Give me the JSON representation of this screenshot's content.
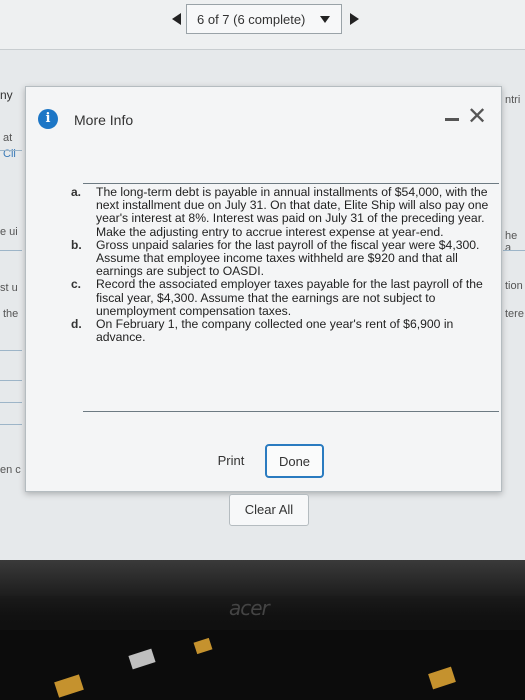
{
  "pager": {
    "label": "6 of 7 (6 complete)"
  },
  "background": {
    "fragments": [
      "ny",
      "at",
      "Cli",
      "e ui",
      "st u",
      "the",
      "en c",
      "ntri",
      "he a",
      "tion",
      "tere"
    ]
  },
  "modal": {
    "title": "More Info",
    "items": [
      {
        "letter": "a.",
        "text": "The long-term debt is payable in annual installments of $54,000, with the next installment due on July 31. On that date, Elite Ship will also pay one year's interest at 8%. Interest was paid on July 31 of the preceding year. Make the adjusting entry to accrue interest expense at year-end."
      },
      {
        "letter": "b.",
        "text": "Gross unpaid salaries for the last payroll of the fiscal year were $4,300. Assume that employee income taxes withheld are $920 and that all earnings are subject to OASDI."
      },
      {
        "letter": "c.",
        "text": "Record the associated employer taxes payable for the last payroll of the fiscal year, $4,300. Assume that the earnings are not subject to unemployment compensation taxes."
      },
      {
        "letter": "d.",
        "text": "On February 1, the company collected one year's rent of $6,900 in advance."
      }
    ],
    "print_label": "Print",
    "done_label": "Done"
  },
  "clear_all_label": "Clear All",
  "monitor": {
    "brand": "acer"
  }
}
